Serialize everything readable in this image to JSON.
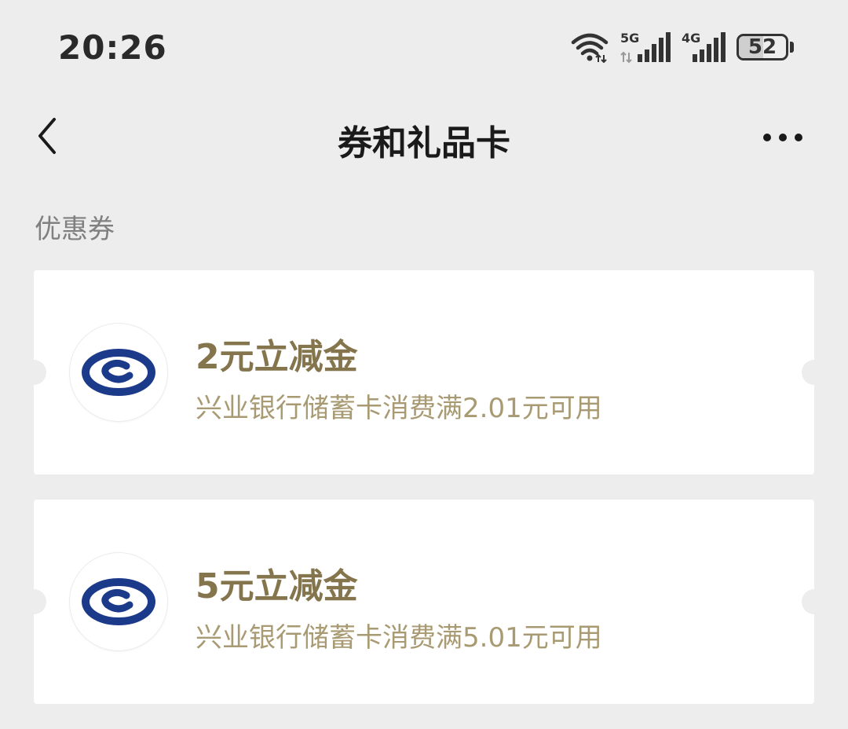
{
  "status_bar": {
    "time": "20:26",
    "battery_level": "52",
    "battery_percent": 52,
    "network_5g_label": "5G",
    "network_4g_label": "4G",
    "icons": [
      "wifi-icon",
      "signal-5g-icon",
      "signal-4g-icon",
      "battery-icon"
    ]
  },
  "nav": {
    "title": "券和礼品卡",
    "back_icon": "chevron-left-icon",
    "more_icon": "more-dots-icon"
  },
  "section": {
    "label": "优惠券"
  },
  "coupons": [
    {
      "title": "2元立减金",
      "description": "兴业银行储蓄卡消费满2.01元可用",
      "logo": "industrial-bank-logo"
    },
    {
      "title": "5元立减金",
      "description": "兴业银行储蓄卡消费满5.01元可用",
      "logo": "industrial-bank-logo"
    }
  ],
  "colors": {
    "background": "#ededed",
    "card": "#ffffff",
    "coupon_title": "#85754d",
    "coupon_desc": "#a89a72",
    "logo_blue": "#1c3a8a"
  }
}
